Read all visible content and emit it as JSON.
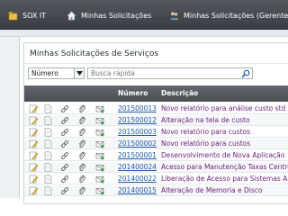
{
  "topnav": {
    "items": [
      {
        "label": "SOX IT",
        "icon": "folder-icon"
      },
      {
        "label": "Minhas Solicitações",
        "icon": "home-icon"
      },
      {
        "label": "Minhas Solicitações (Gerente)",
        "icon": "users-icon"
      }
    ]
  },
  "panel": {
    "title": "Minhas Solicitações de Serviços"
  },
  "filter": {
    "field_value": "Número",
    "search_placeholder": "Busca rápida"
  },
  "table": {
    "headers": {
      "number": "Número",
      "description": "Descrição"
    },
    "rows": [
      {
        "number": "201500013",
        "description": "Novo relatório para análise custo std"
      },
      {
        "number": "201500012",
        "description": "Alteração na tela de custo"
      },
      {
        "number": "201500003",
        "description": "Novo relatório para custos"
      },
      {
        "number": "201500002",
        "description": "Novo relatório para custos"
      },
      {
        "number": "201500001",
        "description": "Desenvolvimento de Nova Aplicação"
      },
      {
        "number": "201400024",
        "description": "Acesso para Manutenção Taxas Centro"
      },
      {
        "number": "201400022",
        "description": "Liberação de Acesso para Sistemas A"
      },
      {
        "number": "201400015",
        "description": "Alteração de Memoria e Disco"
      }
    ]
  },
  "colors": {
    "topbar": "#45494d",
    "header": "#55595e",
    "link": "#1c5aa6",
    "description": "#6a1e7a"
  }
}
